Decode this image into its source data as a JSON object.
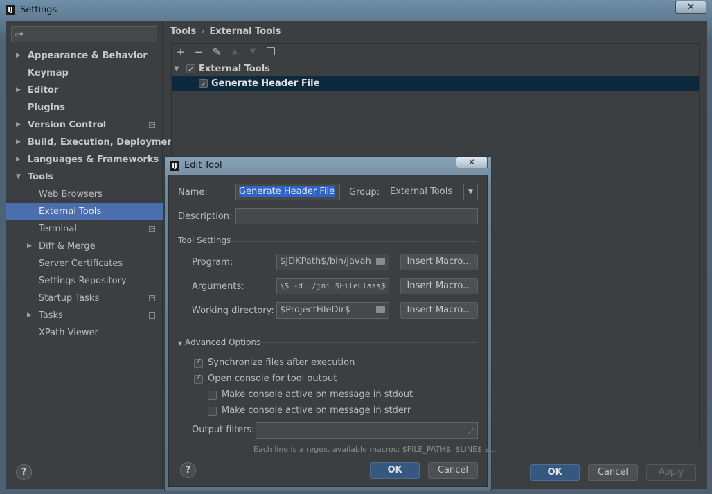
{
  "window": {
    "title": "Settings",
    "close_glyph": "✕"
  },
  "sidebar": {
    "search_placeholder": "",
    "items": [
      {
        "label": "Appearance & Behavior",
        "expandable": true
      },
      {
        "label": "Keymap",
        "expandable": false
      },
      {
        "label": "Editor",
        "expandable": true
      },
      {
        "label": "Plugins",
        "expandable": false
      },
      {
        "label": "Version Control",
        "expandable": true,
        "project_icon": true
      },
      {
        "label": "Build, Execution, Deployment",
        "expandable": true
      },
      {
        "label": "Languages & Frameworks",
        "expandable": true
      },
      {
        "label": "Tools",
        "expanded": true
      },
      {
        "label": "Web Browsers"
      },
      {
        "label": "External Tools",
        "selected": true
      },
      {
        "label": "Terminal",
        "project_icon": true
      },
      {
        "label": "Diff & Merge",
        "expandable": true
      },
      {
        "label": "Server Certificates"
      },
      {
        "label": "Settings Repository"
      },
      {
        "label": "Startup Tasks",
        "project_icon": true
      },
      {
        "label": "Tasks",
        "expandable": true,
        "project_icon": true
      },
      {
        "label": "XPath Viewer"
      }
    ],
    "help_label": "?"
  },
  "breadcrumb": {
    "parent": "Tools",
    "separator": "›",
    "current": "External Tools"
  },
  "toolbar": {
    "add": "+",
    "remove": "−",
    "edit": "✎",
    "up": "▲",
    "down": "▼",
    "copy": "❐"
  },
  "tree": {
    "group": {
      "label": "External Tools",
      "checked": true
    },
    "tool": {
      "label": "Generate Header File",
      "checked": true
    }
  },
  "footer": {
    "ok": "OK",
    "cancel": "Cancel",
    "apply": "Apply"
  },
  "edit_tool": {
    "title": "Edit Tool",
    "close_glyph": "✕",
    "name_label": "Name:",
    "name_value": "Generate Header File",
    "group_label": "Group:",
    "group_value": "External Tools",
    "description_label": "Description:",
    "description_value": "",
    "tool_settings_label": "Tool Settings",
    "program_label": "Program:",
    "program_value": "$JDKPath$/bin/javah",
    "arguments_label": "Arguments:",
    "arguments_value": "\\$ -d ./jni $FileClass$",
    "working_dir_label": "Working directory:",
    "working_dir_value": "$ProjectFileDir$",
    "insert_macro": "Insert Macro...",
    "advanced_label": "Advanced Options",
    "sync_files": {
      "label": "Synchronize files after execution",
      "checked": true
    },
    "open_console": {
      "label": "Open console for tool output",
      "checked": true
    },
    "console_stdout": {
      "label": "Make console active on message in stdout",
      "checked": false
    },
    "console_stderr": {
      "label": "Make console active on message in stderr",
      "checked": false
    },
    "output_filters_label": "Output filters:",
    "output_filters_value": "",
    "hint": "Each line is a regex, available macros: $FILE_PATH$, $LINE$ a...",
    "ok": "OK",
    "cancel": "Cancel",
    "help_label": "?"
  },
  "colors": {
    "selection": "#4b6eaf",
    "tree_selection": "#0d293e",
    "primary_button": "#365880"
  }
}
